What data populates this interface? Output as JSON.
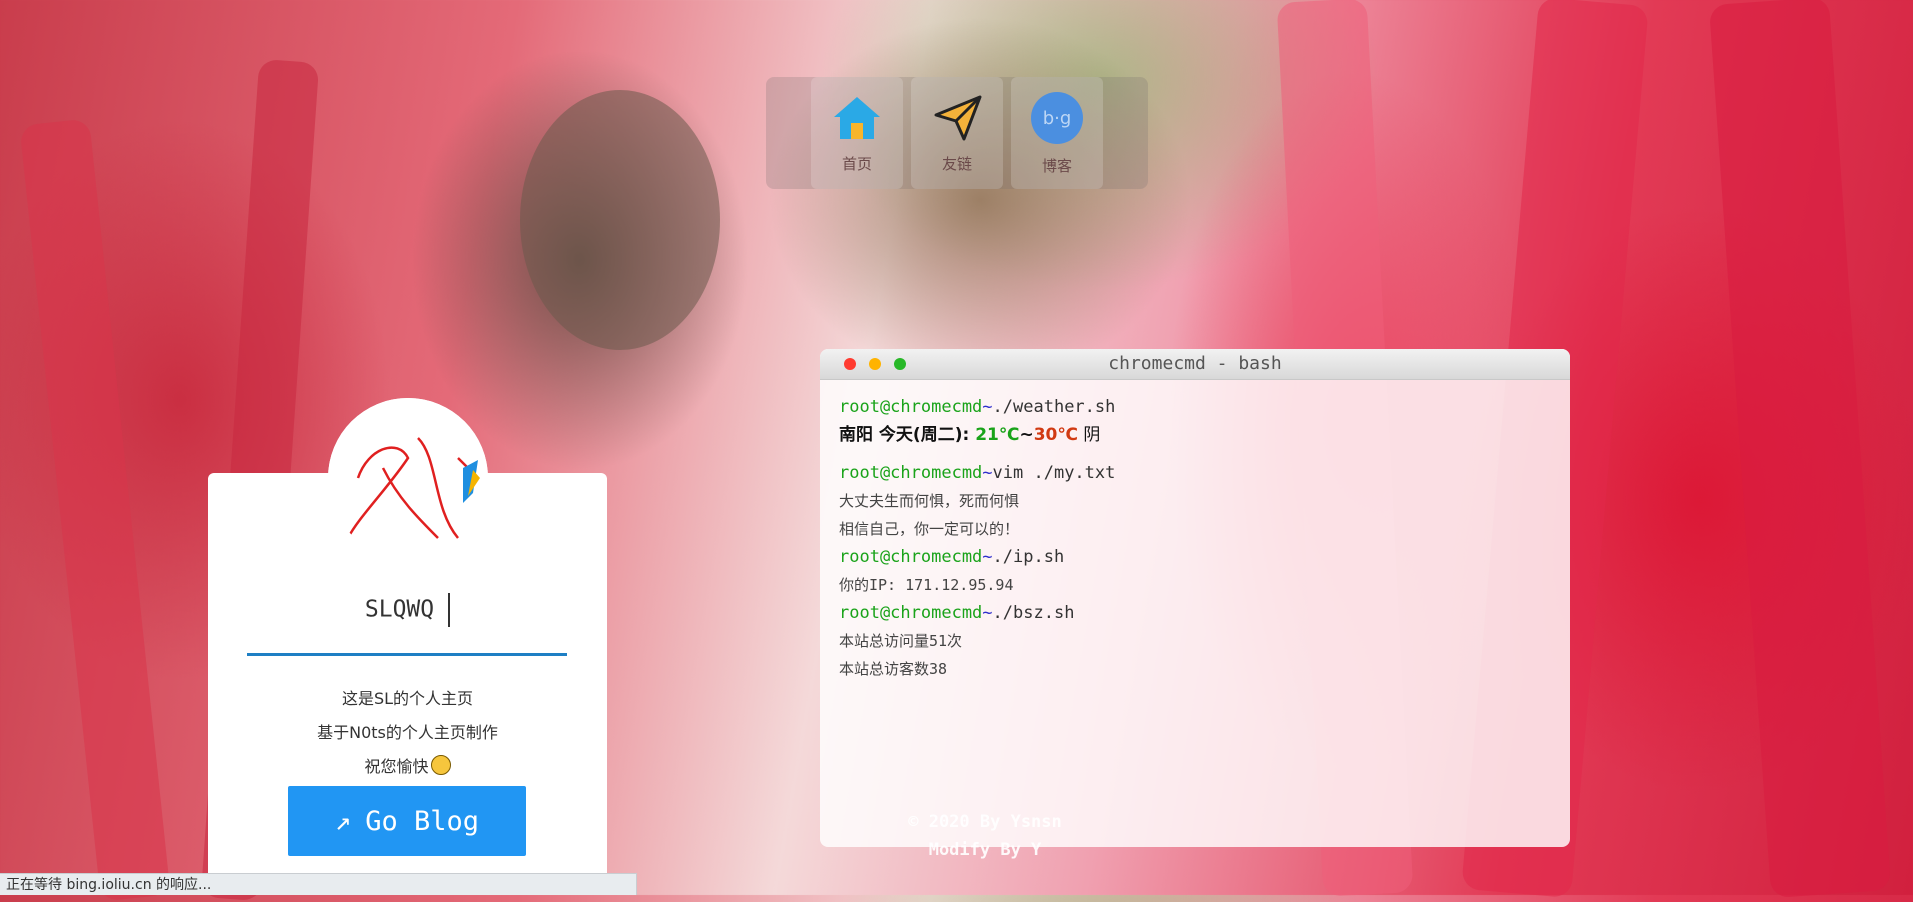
{
  "nav": {
    "items": [
      {
        "label": "首页",
        "icon": "home-icon"
      },
      {
        "label": "友链",
        "icon": "send-icon"
      },
      {
        "label": "博客",
        "icon": "blog-icon"
      }
    ]
  },
  "profile": {
    "name": "SLQWQ",
    "lines": [
      "这是SL的个人主页",
      "基于N0ts的个人主页制作",
      "祝您愉快"
    ],
    "button_label": "Go Blog",
    "button_icon": "↗"
  },
  "terminal": {
    "title": "chromecmd - bash",
    "prompt_user": "root@chromecmd",
    "prompt_path": "~",
    "commands": {
      "weather": "./weather.sh",
      "vim": "vim ./my.txt",
      "ip": "./ip.sh",
      "bsz": "./bsz.sh"
    },
    "weather": {
      "prefix": "南阳 今天(周二): ",
      "low": "21℃",
      "sep": "~",
      "high": "30℃",
      "condition": " 阴"
    },
    "txt_lines": [
      "大丈夫生而何惧，死而何惧",
      "相信自己，你一定可以的！"
    ],
    "ip_line": "你的IP: 171.12.95.94",
    "visits_line": "本站总访问量51次",
    "visitors_line": "本站总访客数38"
  },
  "footer": {
    "line1": "© 2020 By Ysnsn",
    "line2": "Modify By Y"
  },
  "status_bar": {
    "text": "正在等待 bing.ioliu.cn 的响应..."
  },
  "colors": {
    "accent": "#2196f3",
    "prompt_green": "#1aa31a",
    "high_temp": "#d13a12"
  }
}
